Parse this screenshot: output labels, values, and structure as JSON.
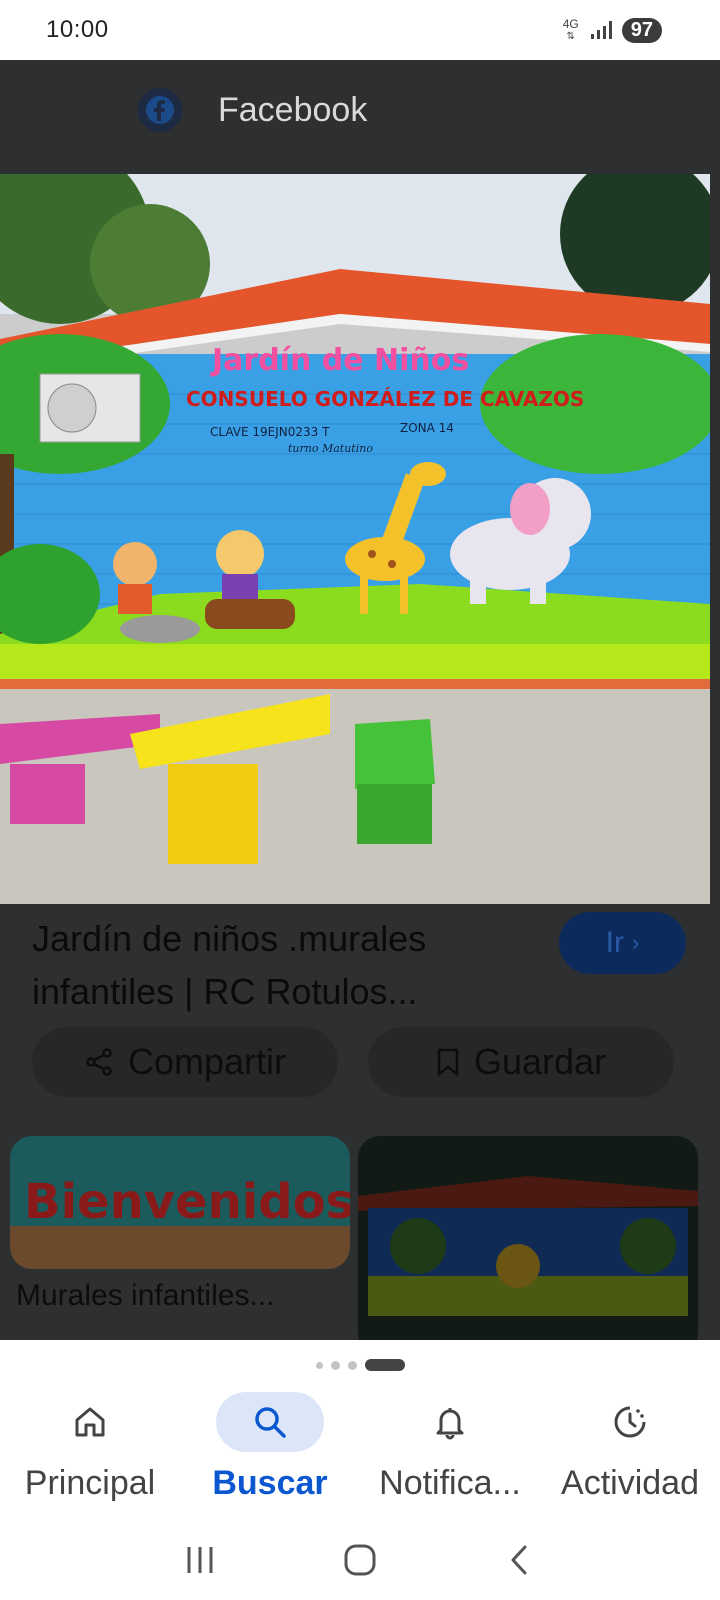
{
  "status_bar": {
    "time": "10:00",
    "network_type": "4G",
    "battery_level": "97"
  },
  "viewer": {
    "source_name": "Facebook",
    "source_icon": "facebook-icon",
    "image_alt_text": {
      "mural_title": "Jardín de Niños",
      "mural_subtitle": "CONSUELO GONZÁLEZ DE CAVAZOS",
      "mural_clave": "CLAVE 19EJN0233 T",
      "mural_zona": "ZONA 14",
      "mural_turno": "turno Matutino"
    },
    "title": "Jardín de niños .murales infantiles | RC Rotulos...",
    "go_button_label": "Ir",
    "share_label": "Compartir",
    "save_label": "Guardar"
  },
  "related": {
    "thumb1_text": "Bienvenidos",
    "thumb1_caption": "Murales infantiles..."
  },
  "page_indicator": {
    "count": 4,
    "active_index": 3
  },
  "bottom_nav": {
    "items": [
      {
        "label": "Principal",
        "icon": "home-icon",
        "active": false
      },
      {
        "label": "Buscar",
        "icon": "search-icon",
        "active": true
      },
      {
        "label": "Notifica...",
        "icon": "bell-icon",
        "active": false
      },
      {
        "label": "Actividad",
        "icon": "activity-icon",
        "active": false
      }
    ]
  },
  "colors": {
    "accent": "#0b57d0",
    "overlay": "#2e2f31",
    "active_nav_bg": "#dde6f8"
  }
}
